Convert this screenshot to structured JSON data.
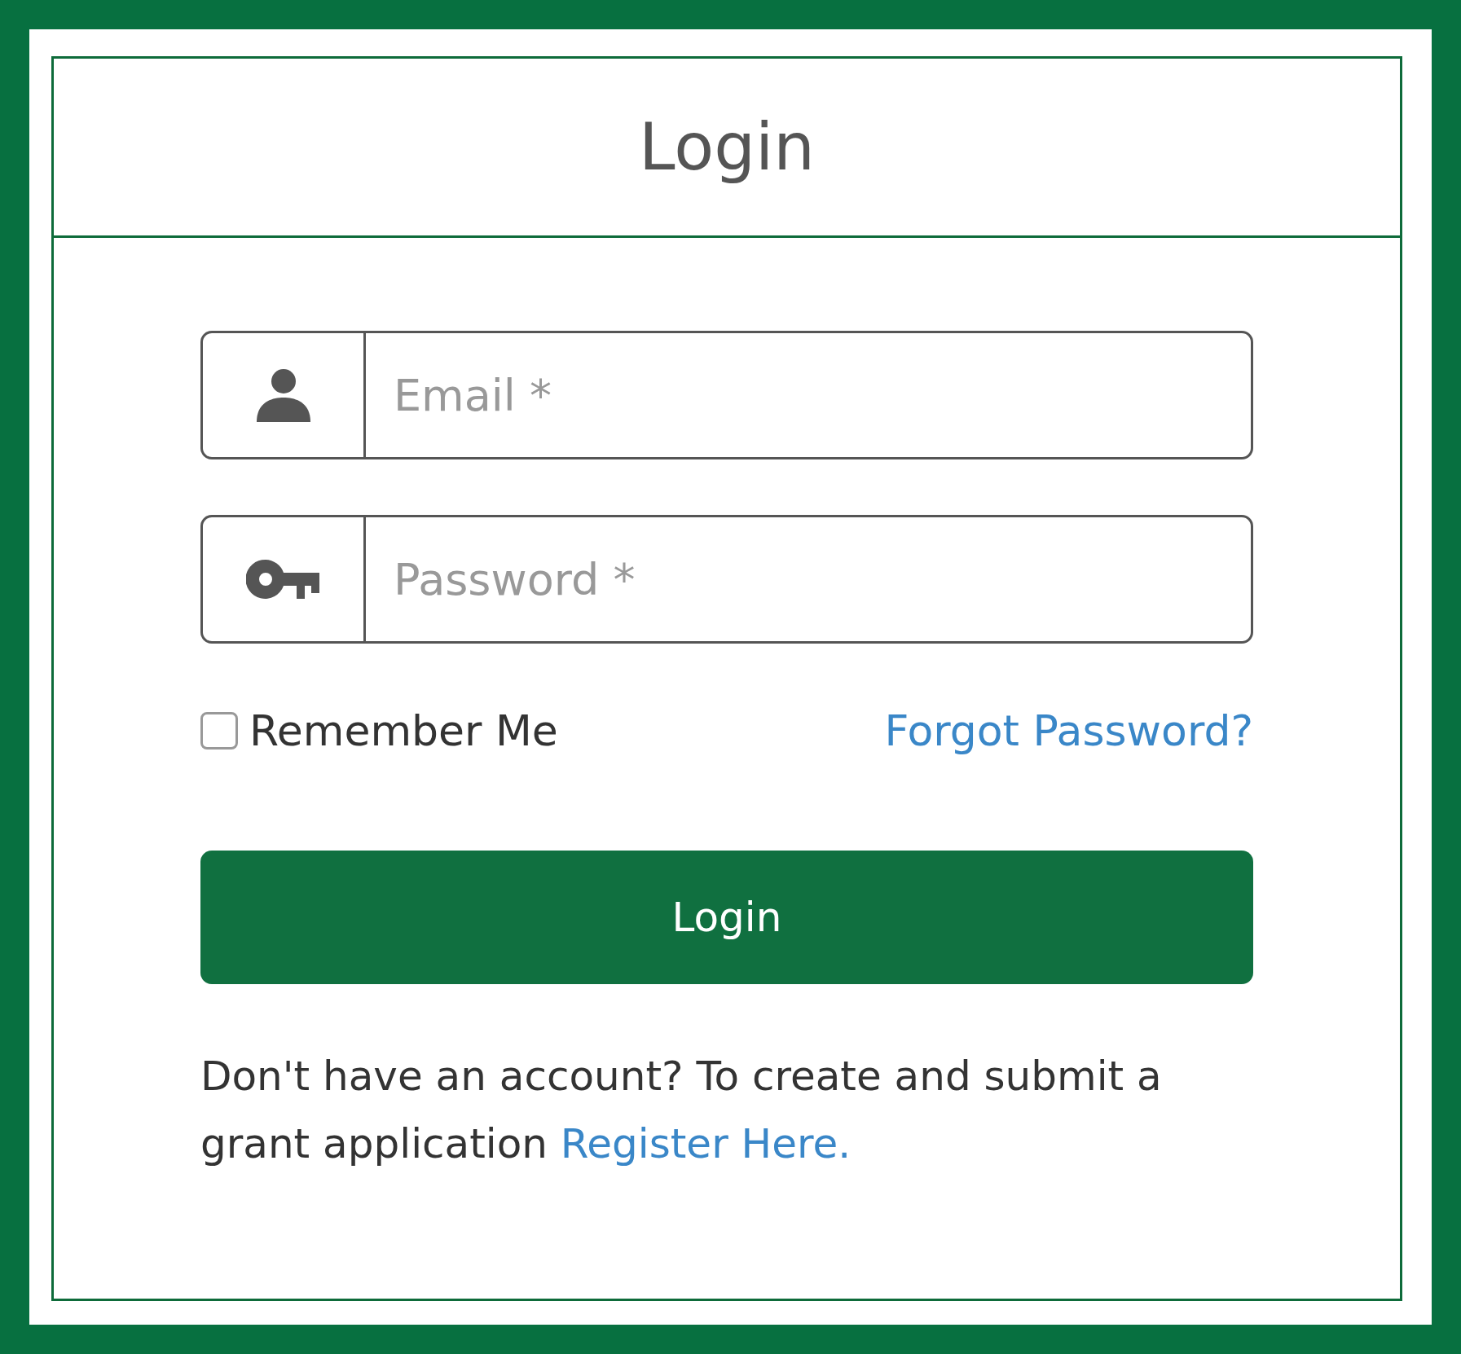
{
  "title": "Login",
  "fields": [
    {
      "kind": "email",
      "placeholder": "Email *"
    },
    {
      "kind": "password",
      "placeholder": "Password *"
    }
  ],
  "remember": {
    "label": "Remember Me",
    "checked": false
  },
  "forgot_link": "Forgot Password?",
  "submit_button": "Login",
  "footer": {
    "text": "Don't have an account? To create and submit a grant application",
    "link": "Register Here."
  }
}
